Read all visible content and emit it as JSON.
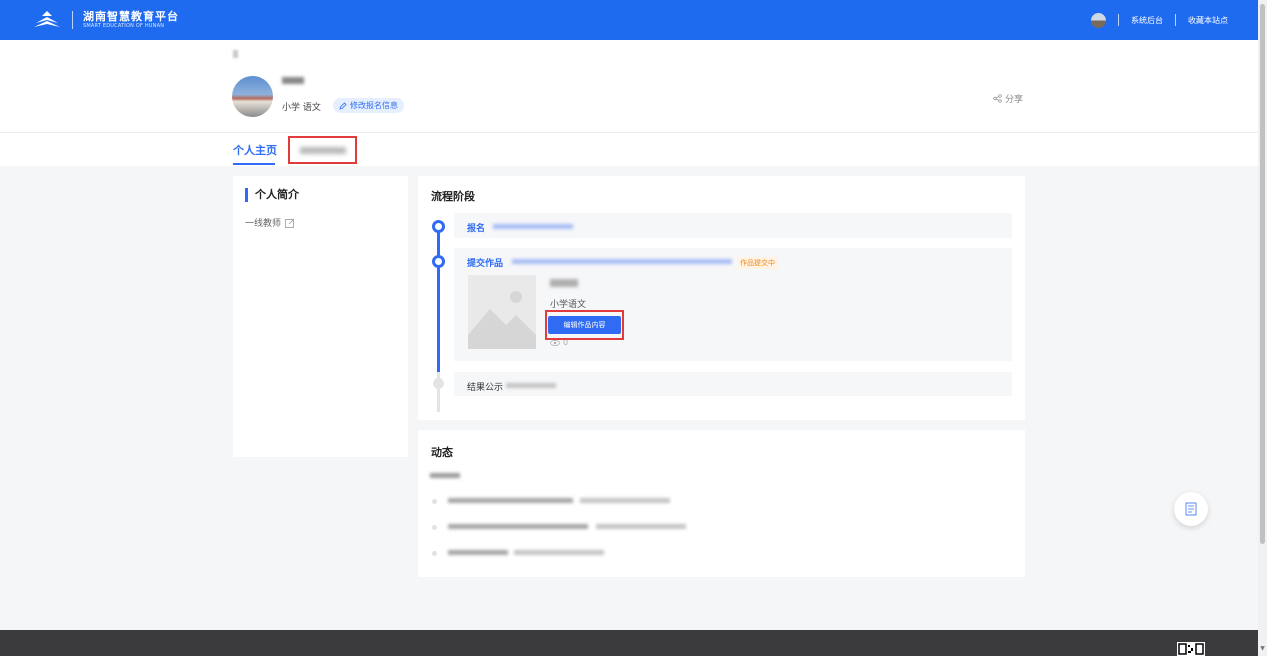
{
  "header": {
    "logo_cn": "湖南智慧教育平台",
    "logo_en": "SMART EDUCATION OF HUNAN",
    "admin_link": "系统后台",
    "bookmark_link": "收藏本站点",
    "brand_color": "#1f6bf0"
  },
  "profile": {
    "subject": "小学 语文",
    "edit_signup": "修改报名信息",
    "share": "分享"
  },
  "tabs": {
    "home": "个人主页"
  },
  "intro": {
    "title": "个人简介",
    "text": "一线教师"
  },
  "process": {
    "title": "流程阶段",
    "steps": [
      {
        "label": "报名"
      },
      {
        "label": "提交作品",
        "status": "作品提交中"
      },
      {
        "label": "结果公示"
      }
    ],
    "work": {
      "subject": "小学语文",
      "edit_button": "编辑作品内容",
      "views": "0"
    }
  },
  "activity": {
    "title": "动态"
  }
}
